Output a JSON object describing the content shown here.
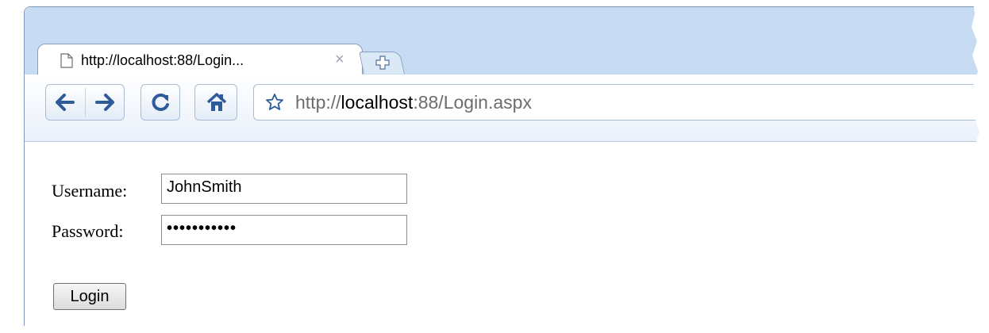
{
  "tab": {
    "title": "http://localhost:88/Login...",
    "close": "×"
  },
  "address": {
    "prefix": "http://",
    "host": "localhost",
    "rest": ":88/Login.aspx"
  },
  "form": {
    "username_label": "Username:",
    "username_value": "JohnSmith",
    "password_label": "Password:",
    "password_value": "•••••••••••",
    "login_label": "Login"
  },
  "icons": {
    "tab": "document-icon",
    "new_tab": "plus-icon",
    "back": "back-arrow-icon",
    "forward": "forward-arrow-icon",
    "reload": "reload-icon",
    "home": "home-icon",
    "bookmark": "star-icon"
  },
  "colors": {
    "frame": "#c7dcf2",
    "toolbar_icon": "#2e5b9a"
  }
}
